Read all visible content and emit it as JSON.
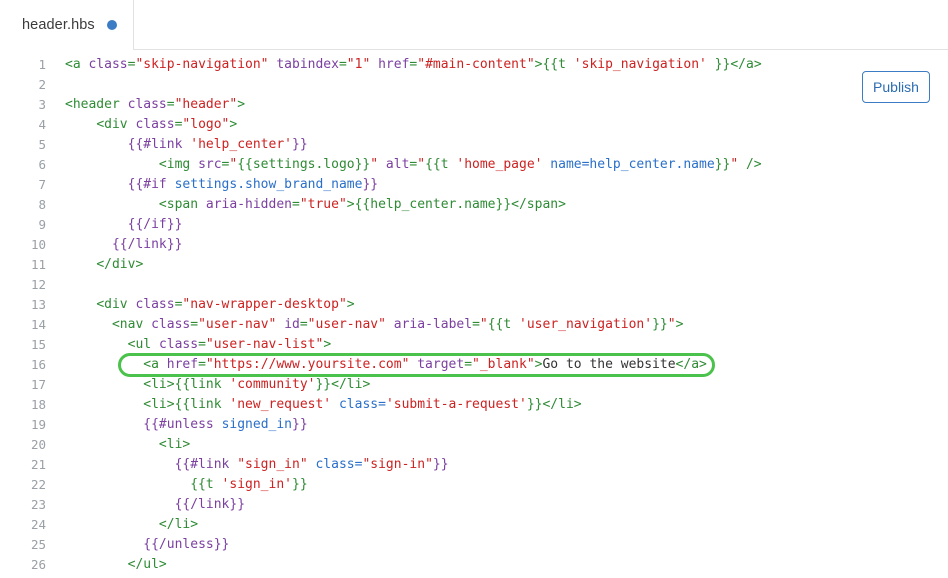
{
  "tab": {
    "filename": "header.hbs",
    "unsaved_indicator": "unsaved-dot",
    "dot_color": "#3b7cc4"
  },
  "toolbar": {
    "publish_label": "Publish",
    "publish_color": "#3b7cc4"
  },
  "editor": {
    "language": "handlebars",
    "first_line": 1,
    "last_visible_line": 26,
    "highlight": {
      "line": 16,
      "border_color": "#4bc24b",
      "text": "<a href=\"https://www.yoursite.com\" target=\"_blank\">Go to the website</a>"
    },
    "syntax_colors": {
      "tag": "#2e8b34",
      "attribute": "#7b3fa0",
      "string": "#cc2222",
      "handlebars_block": "#7b3fa0",
      "variable": "#2a6fc9",
      "text": "#333333",
      "line_number": "#9aa0a6"
    },
    "lines": [
      {
        "n": 1,
        "indent": 0,
        "tokens": [
          {
            "t": "tag",
            "v": "<a "
          },
          {
            "t": "attr",
            "v": "class"
          },
          {
            "t": "tag",
            "v": "="
          },
          {
            "t": "str",
            "v": "\"skip-navigation\""
          },
          {
            "t": "tag",
            "v": " "
          },
          {
            "t": "attr",
            "v": "tabindex"
          },
          {
            "t": "tag",
            "v": "="
          },
          {
            "t": "str",
            "v": "\"1\""
          },
          {
            "t": "tag",
            "v": " "
          },
          {
            "t": "attr",
            "v": "href"
          },
          {
            "t": "tag",
            "v": "="
          },
          {
            "t": "str",
            "v": "\"#main-content\""
          },
          {
            "t": "tag",
            "v": ">"
          },
          {
            "t": "hbg",
            "v": "{{t "
          },
          {
            "t": "str",
            "v": "'skip_navigation'"
          },
          {
            "t": "hbg",
            "v": " }}"
          },
          {
            "t": "tag",
            "v": "</a>"
          }
        ]
      },
      {
        "n": 2,
        "indent": 0,
        "tokens": []
      },
      {
        "n": 3,
        "indent": 0,
        "tokens": [
          {
            "t": "tag",
            "v": "<header "
          },
          {
            "t": "attr",
            "v": "class"
          },
          {
            "t": "tag",
            "v": "="
          },
          {
            "t": "str",
            "v": "\"header\""
          },
          {
            "t": "tag",
            "v": ">"
          }
        ]
      },
      {
        "n": 4,
        "indent": 2,
        "tokens": [
          {
            "t": "tag",
            "v": "<div "
          },
          {
            "t": "attr",
            "v": "class"
          },
          {
            "t": "tag",
            "v": "="
          },
          {
            "t": "str",
            "v": "\"logo\""
          },
          {
            "t": "tag",
            "v": ">"
          }
        ]
      },
      {
        "n": 5,
        "indent": 4,
        "tokens": [
          {
            "t": "hb",
            "v": "{{#link "
          },
          {
            "t": "str",
            "v": "'help_center'"
          },
          {
            "t": "hb",
            "v": "}}"
          }
        ]
      },
      {
        "n": 6,
        "indent": 6,
        "tokens": [
          {
            "t": "tag",
            "v": "<img "
          },
          {
            "t": "attr",
            "v": "src"
          },
          {
            "t": "tag",
            "v": "="
          },
          {
            "t": "str",
            "v": "\""
          },
          {
            "t": "hbg",
            "v": "{{settings.logo}}"
          },
          {
            "t": "str",
            "v": "\""
          },
          {
            "t": "tag",
            "v": " "
          },
          {
            "t": "attr",
            "v": "alt"
          },
          {
            "t": "tag",
            "v": "="
          },
          {
            "t": "str",
            "v": "\""
          },
          {
            "t": "hbg",
            "v": "{{t "
          },
          {
            "t": "str",
            "v": "'home_page'"
          },
          {
            "t": "tag",
            "v": " "
          },
          {
            "t": "var",
            "v": "name=help_center.name"
          },
          {
            "t": "hbg",
            "v": "}}"
          },
          {
            "t": "str",
            "v": "\""
          },
          {
            "t": "tag",
            "v": " />"
          }
        ]
      },
      {
        "n": 7,
        "indent": 4,
        "tokens": [
          {
            "t": "hb",
            "v": "{{#if "
          },
          {
            "t": "var",
            "v": "settings.show_brand_name"
          },
          {
            "t": "hb",
            "v": "}}"
          }
        ]
      },
      {
        "n": 8,
        "indent": 6,
        "tokens": [
          {
            "t": "tag",
            "v": "<span "
          },
          {
            "t": "attr",
            "v": "aria-hidden"
          },
          {
            "t": "tag",
            "v": "="
          },
          {
            "t": "str",
            "v": "\"true\""
          },
          {
            "t": "tag",
            "v": ">"
          },
          {
            "t": "hbg",
            "v": "{{help_center.name}}"
          },
          {
            "t": "tag",
            "v": "</span>"
          }
        ]
      },
      {
        "n": 9,
        "indent": 4,
        "tokens": [
          {
            "t": "hb",
            "v": "{{/if}}"
          }
        ]
      },
      {
        "n": 10,
        "indent": 3,
        "tokens": [
          {
            "t": "hb",
            "v": "{{/link}}"
          }
        ]
      },
      {
        "n": 11,
        "indent": 2,
        "tokens": [
          {
            "t": "tag",
            "v": "</div>"
          }
        ]
      },
      {
        "n": 12,
        "indent": 0,
        "tokens": []
      },
      {
        "n": 13,
        "indent": 2,
        "tokens": [
          {
            "t": "tag",
            "v": "<div "
          },
          {
            "t": "attr",
            "v": "class"
          },
          {
            "t": "tag",
            "v": "="
          },
          {
            "t": "str",
            "v": "\"nav-wrapper-desktop\""
          },
          {
            "t": "tag",
            "v": ">"
          }
        ]
      },
      {
        "n": 14,
        "indent": 3,
        "tokens": [
          {
            "t": "tag",
            "v": "<nav "
          },
          {
            "t": "attr",
            "v": "class"
          },
          {
            "t": "tag",
            "v": "="
          },
          {
            "t": "str",
            "v": "\"user-nav\""
          },
          {
            "t": "tag",
            "v": " "
          },
          {
            "t": "attr",
            "v": "id"
          },
          {
            "t": "tag",
            "v": "="
          },
          {
            "t": "str",
            "v": "\"user-nav\""
          },
          {
            "t": "tag",
            "v": " "
          },
          {
            "t": "attr",
            "v": "aria-label"
          },
          {
            "t": "tag",
            "v": "="
          },
          {
            "t": "str",
            "v": "\""
          },
          {
            "t": "hbg",
            "v": "{{t "
          },
          {
            "t": "str",
            "v": "'user_navigation'"
          },
          {
            "t": "hbg",
            "v": "}}"
          },
          {
            "t": "str",
            "v": "\""
          },
          {
            "t": "tag",
            "v": ">"
          }
        ]
      },
      {
        "n": 15,
        "indent": 4,
        "tokens": [
          {
            "t": "tag",
            "v": "<ul "
          },
          {
            "t": "attr",
            "v": "class"
          },
          {
            "t": "tag",
            "v": "="
          },
          {
            "t": "str",
            "v": "\"user-nav-list\""
          },
          {
            "t": "tag",
            "v": ">"
          }
        ]
      },
      {
        "n": 16,
        "indent": 5,
        "highlighted": true,
        "tokens": [
          {
            "t": "tag",
            "v": "<a "
          },
          {
            "t": "attr",
            "v": "href"
          },
          {
            "t": "tag",
            "v": "="
          },
          {
            "t": "str",
            "v": "\"https://www.yoursite.com\""
          },
          {
            "t": "tag",
            "v": " "
          },
          {
            "t": "attr",
            "v": "target"
          },
          {
            "t": "tag",
            "v": "="
          },
          {
            "t": "str",
            "v": "\"_blank\""
          },
          {
            "t": "tag",
            "v": ">"
          },
          {
            "t": "txt",
            "v": "Go to the website"
          },
          {
            "t": "tag",
            "v": "</a>"
          }
        ]
      },
      {
        "n": 17,
        "indent": 5,
        "tokens": [
          {
            "t": "tag",
            "v": "<li>"
          },
          {
            "t": "hbg",
            "v": "{{link "
          },
          {
            "t": "str",
            "v": "'community'"
          },
          {
            "t": "hbg",
            "v": "}}"
          },
          {
            "t": "tag",
            "v": "</li>"
          }
        ]
      },
      {
        "n": 18,
        "indent": 5,
        "tokens": [
          {
            "t": "tag",
            "v": "<li>"
          },
          {
            "t": "hbg",
            "v": "{{link "
          },
          {
            "t": "str",
            "v": "'new_request'"
          },
          {
            "t": "tag",
            "v": " "
          },
          {
            "t": "var",
            "v": "class="
          },
          {
            "t": "str",
            "v": "'submit-a-request'"
          },
          {
            "t": "hbg",
            "v": "}}"
          },
          {
            "t": "tag",
            "v": "</li>"
          }
        ]
      },
      {
        "n": 19,
        "indent": 5,
        "tokens": [
          {
            "t": "hb",
            "v": "{{#unless "
          },
          {
            "t": "var",
            "v": "signed_in"
          },
          {
            "t": "hb",
            "v": "}}"
          }
        ]
      },
      {
        "n": 20,
        "indent": 6,
        "tokens": [
          {
            "t": "tag",
            "v": "<li>"
          }
        ]
      },
      {
        "n": 21,
        "indent": 7,
        "tokens": [
          {
            "t": "hb",
            "v": "{{#link "
          },
          {
            "t": "str",
            "v": "\"sign_in\""
          },
          {
            "t": "tag",
            "v": " "
          },
          {
            "t": "var",
            "v": "class="
          },
          {
            "t": "str",
            "v": "\"sign-in\""
          },
          {
            "t": "hb",
            "v": "}}"
          }
        ]
      },
      {
        "n": 22,
        "indent": 8,
        "tokens": [
          {
            "t": "hbg",
            "v": "{{t "
          },
          {
            "t": "str",
            "v": "'sign_in'"
          },
          {
            "t": "hbg",
            "v": "}}"
          }
        ]
      },
      {
        "n": 23,
        "indent": 7,
        "tokens": [
          {
            "t": "hb",
            "v": "{{/link}}"
          }
        ]
      },
      {
        "n": 24,
        "indent": 6,
        "tokens": [
          {
            "t": "tag",
            "v": "</li>"
          }
        ]
      },
      {
        "n": 25,
        "indent": 5,
        "tokens": [
          {
            "t": "hb",
            "v": "{{/unless}}"
          }
        ]
      },
      {
        "n": 26,
        "indent": 4,
        "tokens": [
          {
            "t": "tag",
            "v": "</ul>"
          }
        ]
      }
    ]
  }
}
